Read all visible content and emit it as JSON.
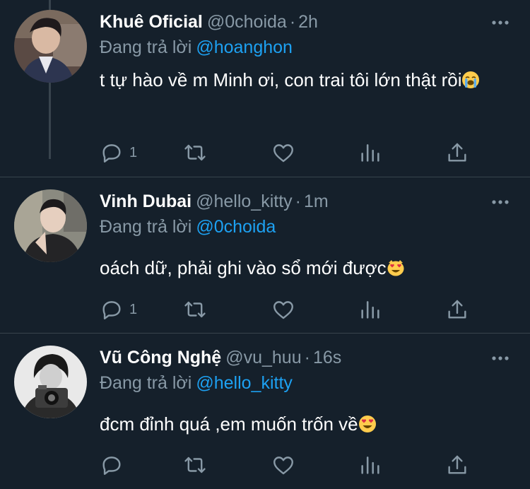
{
  "colors": {
    "background": "#15202b",
    "primary_text": "#ffffff",
    "secondary_text": "#8899a6",
    "mention": "#1da1f2",
    "divider": "#38444d"
  },
  "reply_prefix": "Đang trả lời",
  "tweets": [
    {
      "display_name": "Khuê Oficial",
      "handle": "@0choida",
      "time": "2h",
      "replying_to": "@hoanghon",
      "text": "t tự hào về m Minh ơi, con trai tôi lớn thật rồi",
      "emoji": "loudly-crying-face",
      "reply_count": "1",
      "icons": [
        "reply-icon",
        "retweet-icon",
        "like-icon",
        "analytics-icon",
        "share-icon",
        "more-icon"
      ]
    },
    {
      "display_name": "Vinh Dubai",
      "handle": "@hello_kitty",
      "time": "1m",
      "replying_to": "@0choida",
      "text": "oách dữ, phải ghi vào sổ mới được",
      "emoji": "smiling-cat-heart-eyes",
      "reply_count": "1",
      "icons": [
        "reply-icon",
        "retweet-icon",
        "like-icon",
        "analytics-icon",
        "share-icon",
        "more-icon"
      ]
    },
    {
      "display_name": "Vũ Công Nghệ",
      "handle": "@vu_huu",
      "time": "16s",
      "replying_to": "@hello_kitty",
      "text": "đcm đỉnh quá ,em muốn trốn về",
      "emoji": "smiling-face-heart-eyes",
      "reply_count": "",
      "icons": [
        "reply-icon",
        "retweet-icon",
        "like-icon",
        "analytics-icon",
        "share-icon",
        "more-icon"
      ]
    }
  ],
  "dot_separator": "·"
}
